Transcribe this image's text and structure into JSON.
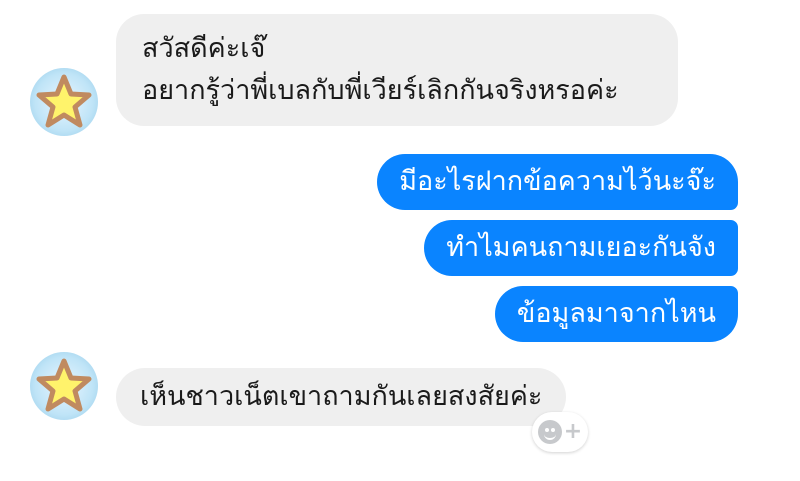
{
  "messages": {
    "first": {
      "line1": "สวัสดีค่ะเจ๊",
      "line2": "อยากรู้ว่าพี่เบลกับพี่เวียร์เลิกกันจริงหรอค่ะ"
    },
    "reply1": "มีอะไรฝากข้อความไว้นะจ๊ะ",
    "reply2": "ทำไมคนถามเยอะกันจัง",
    "reply3": "ข้อมูลมาจากไหน",
    "last": "เห็นชาวเน็ตเขาถามกันเลยสงสัยค่ะ"
  },
  "reaction_button": {
    "icon": "smiley-add-reaction-icon",
    "plus": "+"
  },
  "colors": {
    "outgoing": "#0a84ff",
    "incoming": "#efefef",
    "avatar_star": "#fff36b"
  }
}
